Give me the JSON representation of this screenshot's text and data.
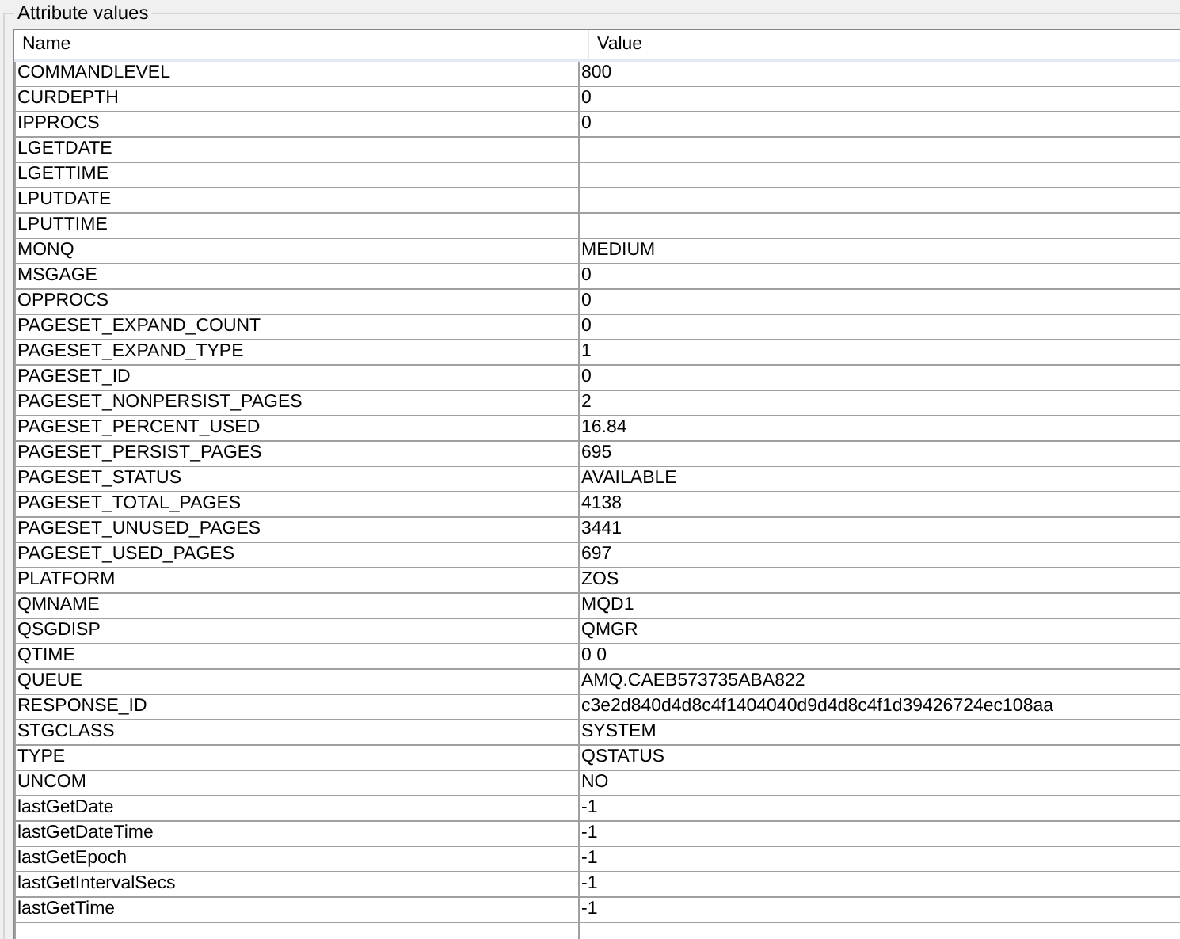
{
  "group_title": "Attribute values",
  "table": {
    "columns": [
      "Name",
      "Value"
    ],
    "rows": [
      [
        "COMMANDLEVEL",
        "800"
      ],
      [
        "CURDEPTH",
        "0"
      ],
      [
        "IPPROCS",
        "0"
      ],
      [
        "LGETDATE",
        ""
      ],
      [
        "LGETTIME",
        ""
      ],
      [
        "LPUTDATE",
        ""
      ],
      [
        "LPUTTIME",
        ""
      ],
      [
        "MONQ",
        "MEDIUM"
      ],
      [
        "MSGAGE",
        "0"
      ],
      [
        "OPPROCS",
        "0"
      ],
      [
        "PAGESET_EXPAND_COUNT",
        "0"
      ],
      [
        "PAGESET_EXPAND_TYPE",
        "1"
      ],
      [
        "PAGESET_ID",
        "0"
      ],
      [
        "PAGESET_NONPERSIST_PAGES",
        "2"
      ],
      [
        "PAGESET_PERCENT_USED",
        "16.84"
      ],
      [
        "PAGESET_PERSIST_PAGES",
        "695"
      ],
      [
        "PAGESET_STATUS",
        "AVAILABLE"
      ],
      [
        "PAGESET_TOTAL_PAGES",
        "4138"
      ],
      [
        "PAGESET_UNUSED_PAGES",
        "3441"
      ],
      [
        "PAGESET_USED_PAGES",
        "697"
      ],
      [
        "PLATFORM",
        "ZOS"
      ],
      [
        "QMNAME",
        "MQD1"
      ],
      [
        "QSGDISP",
        "QMGR"
      ],
      [
        "QTIME",
        "0 0"
      ],
      [
        "QUEUE",
        "AMQ.CAEB573735ABA822"
      ],
      [
        "RESPONSE_ID",
        "c3e2d840d4d8c4f1404040d9d4d8c4f1d39426724ec108aa"
      ],
      [
        "STGCLASS",
        "SYSTEM"
      ],
      [
        "TYPE",
        "QSTATUS"
      ],
      [
        "UNCOM",
        "NO"
      ],
      [
        "lastGetDate",
        "-1"
      ],
      [
        "lastGetDateTime",
        "-1"
      ],
      [
        "lastGetEpoch",
        "-1"
      ],
      [
        "lastGetIntervalSecs",
        "-1"
      ],
      [
        "lastGetTime",
        "-1"
      ]
    ]
  }
}
